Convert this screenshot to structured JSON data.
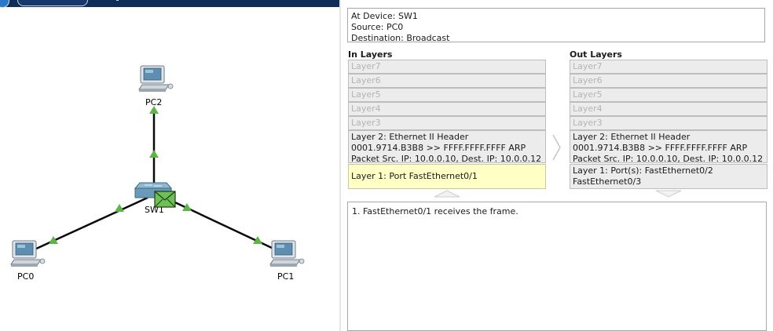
{
  "topology": {
    "devices": [
      {
        "id": "pc2",
        "label": "PC2",
        "icon": "pc-icon"
      },
      {
        "id": "sw1",
        "label": "SW1",
        "icon": "switch-icon"
      },
      {
        "id": "pc0",
        "label": "PC0",
        "icon": "pc-icon"
      },
      {
        "id": "pc1",
        "label": "PC1",
        "icon": "pc-icon"
      }
    ],
    "link_status_color": "#5cb546",
    "envelope_color": "#6fbf57"
  },
  "pdu_info": {
    "at_device": "At Device: SW1",
    "source": "Source: PC0",
    "destination": "Destination: Broadcast",
    "in_layers": {
      "title": "In Layers",
      "layer7": "Layer7",
      "layer6": "Layer6",
      "layer5": "Layer5",
      "layer4": "Layer4",
      "layer3": "Layer3",
      "layer2": "Layer 2: Ethernet II Header 0001.9714.B3B8 >> FFFF.FFFF.FFFF ARP Packet Src. IP: 10.0.0.10, Dest. IP: 10.0.0.12",
      "layer1": "Layer 1: Port FastEthernet0/1"
    },
    "out_layers": {
      "title": "Out Layers",
      "layer7": "Layer7",
      "layer6": "Layer6",
      "layer5": "Layer5",
      "layer4": "Layer4",
      "layer3": "Layer3",
      "layer2": "Layer 2: Ethernet II Header 0001.9714.B3B8 >> FFFF.FFFF.FFFF ARP Packet Src. IP: 10.0.0.10, Dest. IP: 10.0.0.12",
      "layer1_line1": "Layer 1: Port(s): FastEthernet0/2",
      "layer1_line2": "FastEthernet0/3"
    },
    "description": "1. FastEthernet0/1 receives the frame.",
    "active_layer_color": "#ffffc6"
  }
}
